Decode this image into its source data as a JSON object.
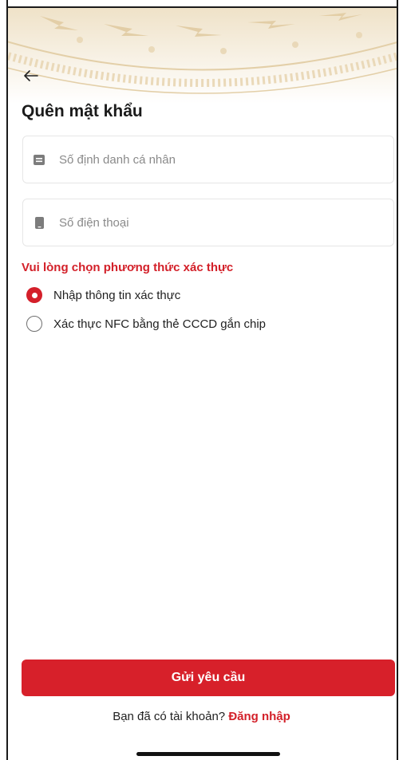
{
  "header": {
    "back_icon": "arrow-left-icon",
    "title": "Quên mật khẩu",
    "pattern_color": "#e9d8b9"
  },
  "form": {
    "id_field": {
      "placeholder": "Số định danh cá nhân",
      "icon": "id-card-icon"
    },
    "phone_field": {
      "placeholder": "Số điện thoại",
      "icon": "phone-icon"
    }
  },
  "verification": {
    "label": "Vui lòng chọn phương thức xác thực",
    "options": [
      {
        "label": "Nhập thông tin xác thực",
        "selected": true
      },
      {
        "label": "Xác thực NFC bằng thẻ CCCD gắn chip",
        "selected": false
      }
    ]
  },
  "actions": {
    "submit_label": "Gửi yêu cầu",
    "login_prompt": "Bạn đã có tài khoản?",
    "login_link": "Đăng nhập"
  },
  "colors": {
    "accent": "#d7202a",
    "text": "#1b1b1b",
    "placeholder": "#8a8a8a",
    "border": "#e6e6e6"
  }
}
